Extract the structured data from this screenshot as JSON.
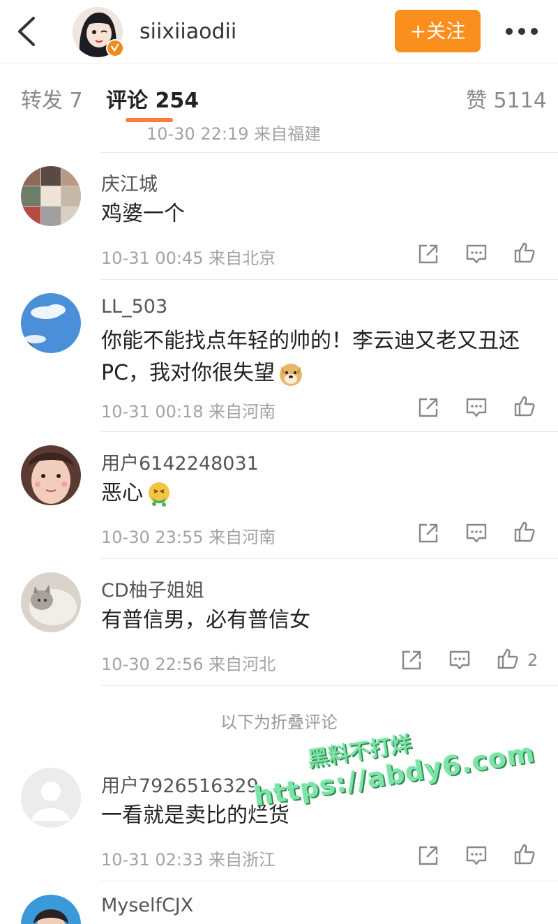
{
  "header": {
    "username": "siixiiaodii",
    "follow_label": "+关注"
  },
  "tabs": {
    "repost": "转发 7",
    "comments": "评论 254",
    "likes": "赞 5114"
  },
  "partial_top_meta": "10-30 22:19 来自福建",
  "comments": [
    {
      "name": "庆江城",
      "text": "鸡婆一个",
      "time": "10-31 00:45",
      "source": "来自北京",
      "likes": ""
    },
    {
      "name": "LL_503",
      "text": "你能不能找点年轻的帅的！李云迪又老又丑还PC，我对你很失望",
      "time": "10-31 00:18",
      "source": "来自河南",
      "likes": ""
    },
    {
      "name": "用户6142248031",
      "text": "恶心",
      "time": "10-30 23:55",
      "source": "来自河南",
      "likes": ""
    },
    {
      "name": "CD柚子姐姐",
      "text": "有普信男，必有普信女",
      "time": "10-30 22:56",
      "source": "来自河北",
      "likes": "2"
    }
  ],
  "fold_label": "以下为折叠评论",
  "folded_comments": [
    {
      "name": "用户7926516329",
      "text": "一看就是卖比的烂货",
      "time": "10-31 02:33",
      "source": "来自浙江"
    },
    {
      "name": "MyselfCJX"
    }
  ],
  "watermark": {
    "line1": "黑料不打烊",
    "line2": "https://abdy6.com"
  },
  "colors": {
    "accent": "#fa8f1e",
    "tab_underline": "#fa7d3c",
    "watermark": "#7ee3a6"
  },
  "icons": [
    "back-icon",
    "verified-badge-icon",
    "more-icon",
    "share-icon",
    "comment-icon",
    "like-icon"
  ]
}
